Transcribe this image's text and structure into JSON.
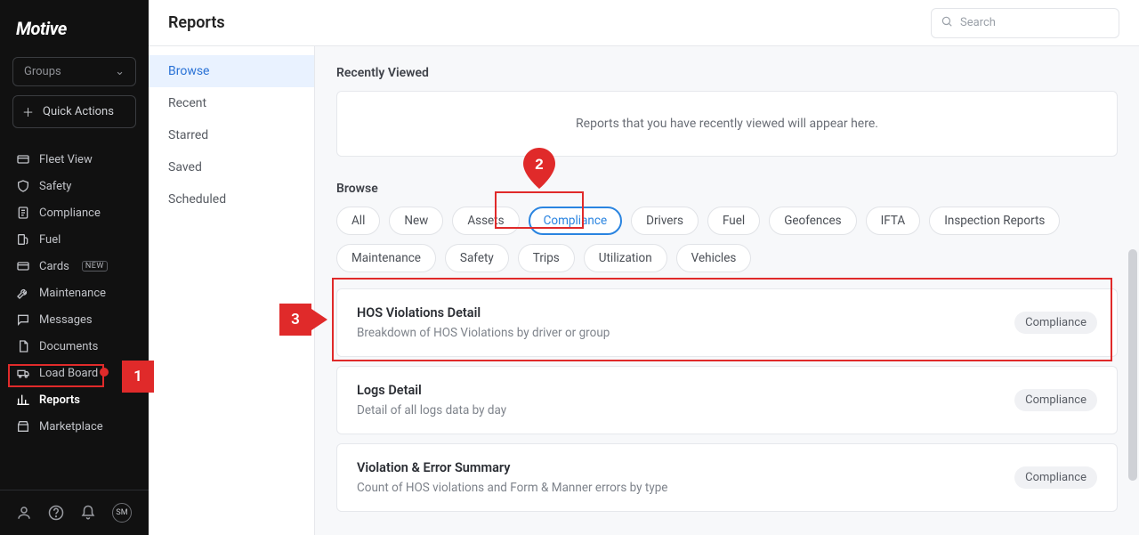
{
  "brand": "Motive",
  "sidebar": {
    "groups_label": "Groups",
    "quick_actions_label": "Quick Actions",
    "items": [
      {
        "label": "Fleet View",
        "icon": "fleet"
      },
      {
        "label": "Safety",
        "icon": "shield"
      },
      {
        "label": "Compliance",
        "icon": "doc"
      },
      {
        "label": "Fuel",
        "icon": "fuel"
      },
      {
        "label": "Cards",
        "icon": "card",
        "badge": "NEW"
      },
      {
        "label": "Maintenance",
        "icon": "wrench"
      },
      {
        "label": "Messages",
        "icon": "msg"
      },
      {
        "label": "Documents",
        "icon": "docs"
      },
      {
        "label": "Load Board",
        "icon": "load",
        "dot": true
      },
      {
        "label": "Reports",
        "icon": "chart",
        "active": true
      },
      {
        "label": "Marketplace",
        "icon": "market"
      }
    ],
    "footer_avatar": "SM"
  },
  "header": {
    "title": "Reports",
    "search_placeholder": "Search"
  },
  "subnav": {
    "items": [
      {
        "label": "Browse",
        "active": true
      },
      {
        "label": "Recent"
      },
      {
        "label": "Starred"
      },
      {
        "label": "Saved"
      },
      {
        "label": "Scheduled"
      }
    ]
  },
  "sections": {
    "recent_title": "Recently Viewed",
    "recent_empty": "Reports that you have recently viewed will appear here.",
    "browse_title": "Browse"
  },
  "chips": [
    "All",
    "New",
    "Assets",
    "Compliance",
    "Drivers",
    "Fuel",
    "Geofences",
    "IFTA",
    "Inspection Reports",
    "Maintenance",
    "Safety",
    "Trips",
    "Utilization",
    "Vehicles"
  ],
  "chip_active": "Compliance",
  "reports": [
    {
      "title": "HOS Violations Detail",
      "desc": "Breakdown of HOS Violations by driver or group",
      "tag": "Compliance"
    },
    {
      "title": "Logs Detail",
      "desc": "Detail of all logs data by day",
      "tag": "Compliance"
    },
    {
      "title": "Violation & Error Summary",
      "desc": "Count of HOS violations and Form & Manner errors by type",
      "tag": "Compliance"
    }
  ],
  "annotations": {
    "1": "1",
    "2": "2",
    "3": "3"
  }
}
